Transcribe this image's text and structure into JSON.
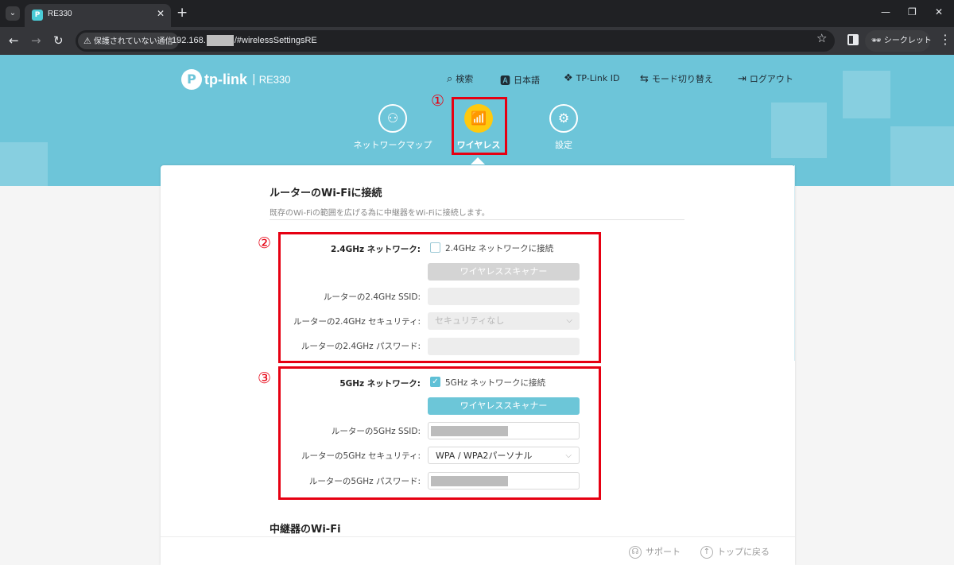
{
  "browser": {
    "tab_title": "RE330",
    "tab_favicon": "P",
    "new_tab": "+",
    "tab_close": "✕",
    "security_label": "保護されていない通信",
    "url_prefix": "192.168.",
    "url_suffix": "/#wirelessSettingsRE",
    "incognito_label": "シークレット"
  },
  "header": {
    "brand": "tp-link",
    "model": "RE330",
    "separator": "|",
    "nav": {
      "search": "検索",
      "language": "日本語",
      "tplink_id": "TP-Link ID",
      "mode_switch": "モード切り替え",
      "logout": "ログアウト"
    },
    "tabs": {
      "network_map": "ネットワークマップ",
      "wireless": "ワイヤレス",
      "settings": "設定"
    }
  },
  "main": {
    "section_title": "ルーターのWi-Fiに接続",
    "section_desc": "既存のWi-Fiの範囲を広げる為に中継器をWi-Fiに接続します。",
    "band24": {
      "label": "2.4GHz ネットワーク:",
      "checkbox_label": "2.4GHz ネットワークに接続",
      "checked": false,
      "scanner_button": "ワイヤレススキャナー",
      "ssid_label": "ルーターの2.4GHz SSID:",
      "ssid_value": "",
      "security_label": "ルーターの2.4GHz セキュリティ:",
      "security_value": "セキュリティなし",
      "password_label": "ルーターの2.4GHz パスワード:",
      "password_value": ""
    },
    "band5": {
      "label": "5GHz ネットワーク:",
      "checkbox_label": "5GHz ネットワークに接続",
      "checked": true,
      "checkmark": "✓",
      "scanner_button": "ワイヤレススキャナー",
      "ssid_label": "ルーターの5GHz SSID:",
      "security_label": "ルーターの5GHz セキュリティ:",
      "security_value": "WPA / WPA2パーソナル",
      "password_label": "ルーターの5GHz パスワード:"
    },
    "extender_title": "中継器のWi-Fi"
  },
  "annotations": {
    "n1": "①",
    "n2": "②",
    "n3": "③",
    "color": "#e60012"
  },
  "footer": {
    "support": "サポート",
    "back_to_top": "トップに戻る"
  },
  "colors": {
    "accent": "#6dc5d9",
    "active_tab": "#ffc90e"
  }
}
